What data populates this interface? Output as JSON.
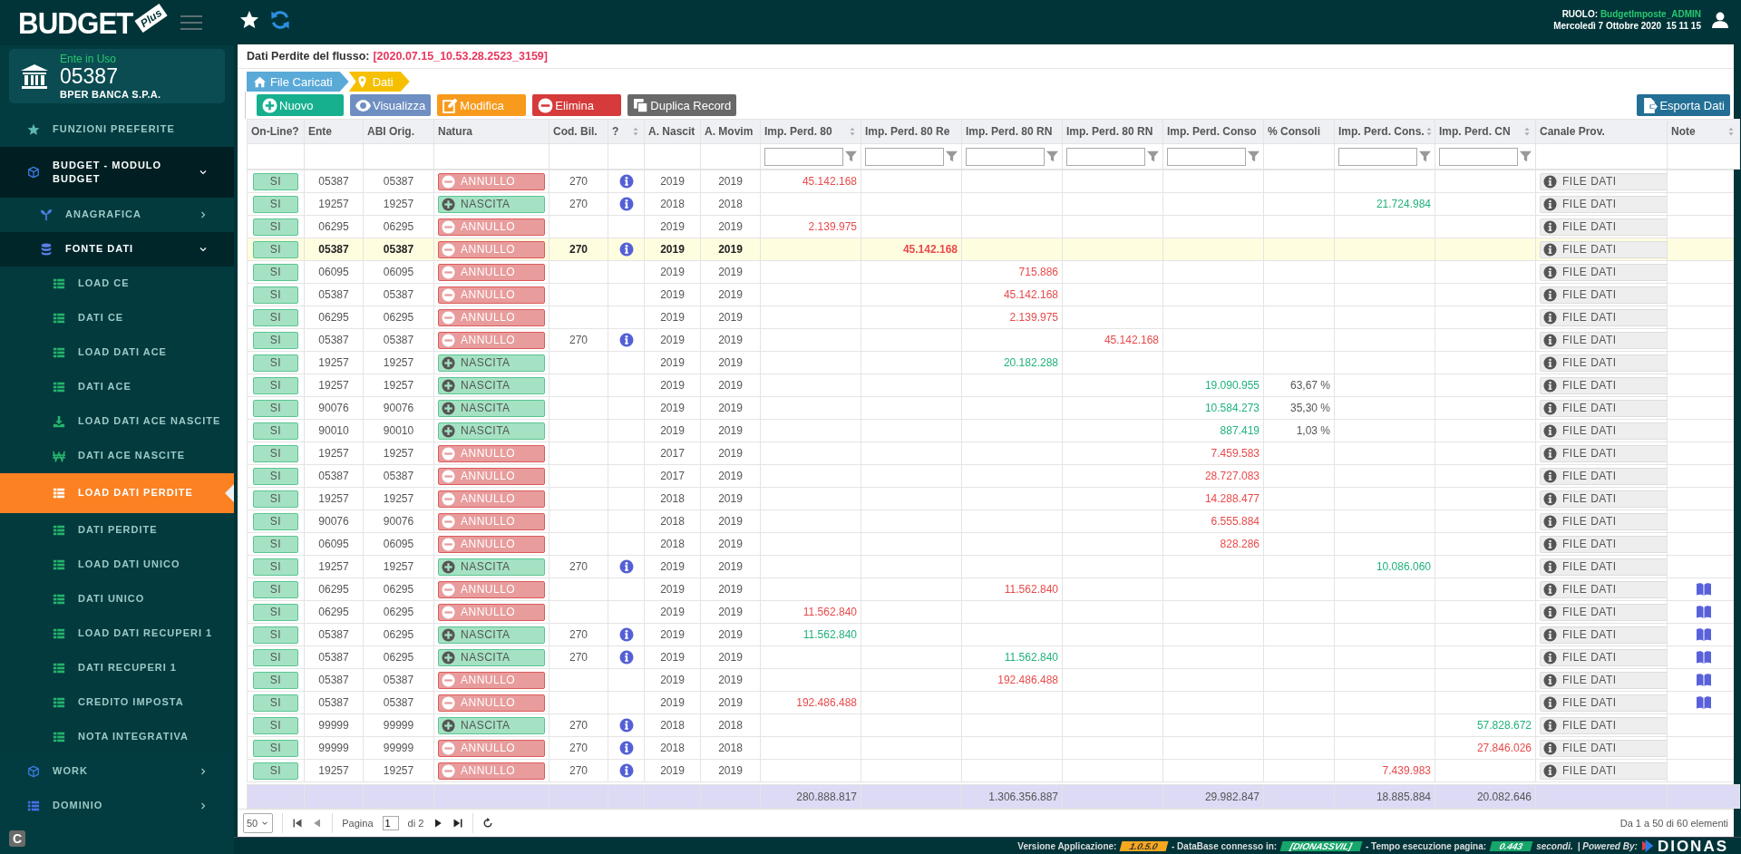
{
  "header": {
    "role_label": "RUOLO:",
    "role": "BudgetImposte_ADMIN",
    "datetime": "Mercoledì 7 Ottobre 2020  15 11 15"
  },
  "sidebar": {
    "logo": {
      "title": "BUDGET",
      "badge": "Plus"
    },
    "ente": {
      "label": "Ente in Uso",
      "code": "05387",
      "name": "BPER BANCA S.P.A."
    },
    "items": [
      {
        "label": "FUNZIONI PREFERITE",
        "kind": "favorites"
      },
      {
        "label": "BUDGET - MODULO BUDGET",
        "kind": "module",
        "expanded": true,
        "children": [
          {
            "label": "ANAGRAFICA",
            "kind": "branch",
            "expanded": false
          },
          {
            "label": "FONTE DATI",
            "kind": "database",
            "expanded": true,
            "children": [
              {
                "label": "LOAD CE",
                "kind": "table",
                "selected": false
              },
              {
                "label": "DATI CE",
                "kind": "table",
                "selected": false
              },
              {
                "label": "LOAD DATI ACE",
                "kind": "table",
                "selected": false
              },
              {
                "label": "DATI ACE",
                "kind": "table",
                "selected": false
              },
              {
                "label": "LOAD DATI ACE NASCITE",
                "kind": "import",
                "selected": false
              },
              {
                "label": "DATI ACE NASCITE",
                "kind": "currency",
                "selected": false
              },
              {
                "label": "LOAD DATI PERDITE",
                "kind": "table",
                "selected": true
              },
              {
                "label": "DATI PERDITE",
                "kind": "table",
                "selected": false
              },
              {
                "label": "LOAD DATI UNICO",
                "kind": "table",
                "selected": false
              },
              {
                "label": "DATI UNICO",
                "kind": "table",
                "selected": false
              },
              {
                "label": "LOAD DATI RECUPERI 1",
                "kind": "table",
                "selected": false
              },
              {
                "label": "DATI RECUPERI 1",
                "kind": "table",
                "selected": false
              },
              {
                "label": "CREDITO IMPOSTA",
                "kind": "table",
                "selected": false
              },
              {
                "label": "NOTA INTEGRATIVA",
                "kind": "table",
                "selected": false
              }
            ]
          }
        ]
      },
      {
        "label": "WORK",
        "kind": "module",
        "expanded": false
      },
      {
        "label": "DOMINIO",
        "kind": "list",
        "expanded": false
      }
    ],
    "corner_badge": "C"
  },
  "panel": {
    "title": "Dati Perdite del flusso:",
    "flow": "[2020.07.15_10.53.28.2523_3159]",
    "breadcrumb": [
      {
        "label": "File Caricati",
        "kind": "home"
      },
      {
        "label": "Dati",
        "kind": "pin"
      }
    ],
    "toolbar": [
      {
        "label": "Nuovo",
        "kind": "new"
      },
      {
        "label": "Visualizza",
        "kind": "view"
      },
      {
        "label": "Modifica",
        "kind": "edit"
      },
      {
        "label": "Elimina",
        "kind": "delete"
      },
      {
        "label": "Duplica Record",
        "kind": "duplicate"
      },
      {
        "label": "Esporta Dati",
        "kind": "export"
      }
    ],
    "table": {
      "columns": [
        {
          "label": "On-Line?",
          "sort_icon": false,
          "filter": false
        },
        {
          "label": "Ente",
          "sort_icon": false,
          "filter": false
        },
        {
          "label": "ABI Orig.",
          "sort_icon": false,
          "filter": false
        },
        {
          "label": "Natura",
          "sort_icon": false,
          "filter": false
        },
        {
          "label": "Cod. Bil.",
          "sort_icon": false,
          "filter": false
        },
        {
          "label": "?",
          "sort_icon": true,
          "filter": false
        },
        {
          "label": "A. Nascit",
          "sort_icon": false,
          "filter": false
        },
        {
          "label": "A. Movim",
          "sort_icon": false,
          "filter": false
        },
        {
          "label": "Imp. Perd. 80",
          "sort_icon": true,
          "filter": true
        },
        {
          "label": "Imp. Perd. 80 Re",
          "sort_icon": false,
          "filter": true
        },
        {
          "label": "Imp. Perd. 80 RN",
          "sort_icon": false,
          "filter": true
        },
        {
          "label": "Imp. Perd. 80 RN",
          "sort_icon": false,
          "filter": true
        },
        {
          "label": "Imp. Perd. Conso",
          "sort_icon": false,
          "filter": true
        },
        {
          "label": "% Consoli",
          "sort_icon": false,
          "filter": false
        },
        {
          "label": "Imp. Perd. Cons.",
          "sort_icon": true,
          "filter": true
        },
        {
          "label": "Imp. Perd. CN",
          "sort_icon": true,
          "filter": true
        },
        {
          "label": "Canale Prov.",
          "sort_icon": false,
          "filter": false
        },
        {
          "label": "Note",
          "sort_icon": true,
          "filter": false
        }
      ],
      "rows": [
        {
          "online": "SI",
          "ente": "05387",
          "abi_orig": "05387",
          "natura": {
            "label": "ANNULLO",
            "kind": "annullo"
          },
          "cod_bil": "270",
          "info": true,
          "a_nascita": "2019",
          "a_movim": "2019",
          "imp_perd_80": {
            "value": "45.142.168",
            "kind": "negative"
          },
          "canale": "FILE DATI",
          "note": false,
          "selected": false
        },
        {
          "online": "SI",
          "ente": "19257",
          "abi_orig": "19257",
          "natura": {
            "label": "NASCITA",
            "kind": "nascita"
          },
          "cod_bil": "270",
          "info": true,
          "a_nascita": "2018",
          "a_movim": "2018",
          "imp_perd_cons": {
            "value": "21.724.984",
            "kind": "positive"
          },
          "canale": "FILE DATI",
          "note": false,
          "selected": false
        },
        {
          "online": "SI",
          "ente": "06295",
          "abi_orig": "06295",
          "natura": {
            "label": "ANNULLO",
            "kind": "annullo"
          },
          "info": false,
          "a_nascita": "2019",
          "a_movim": "2019",
          "imp_perd_80": {
            "value": "2.139.975",
            "kind": "negative"
          },
          "canale": "FILE DATI",
          "note": false,
          "selected": false
        },
        {
          "online": "SI",
          "ente": "05387",
          "abi_orig": "05387",
          "natura": {
            "label": "ANNULLO",
            "kind": "annullo"
          },
          "cod_bil": "270",
          "info": true,
          "a_nascita": "2019",
          "a_movim": "2019",
          "imp_perd_80_rec": {
            "value": "45.142.168",
            "kind": "negative"
          },
          "canale": "FILE DATI",
          "note": false,
          "selected": true
        },
        {
          "online": "SI",
          "ente": "06095",
          "abi_orig": "06095",
          "natura": {
            "label": "ANNULLO",
            "kind": "annullo"
          },
          "info": false,
          "a_nascita": "2019",
          "a_movim": "2019",
          "imp_perd_80_rn": {
            "value": "715.886",
            "kind": "negative"
          },
          "canale": "FILE DATI",
          "note": false,
          "selected": false
        },
        {
          "online": "SI",
          "ente": "05387",
          "abi_orig": "05387",
          "natura": {
            "label": "ANNULLO",
            "kind": "annullo"
          },
          "info": false,
          "a_nascita": "2019",
          "a_movim": "2019",
          "imp_perd_80_rn": {
            "value": "45.142.168",
            "kind": "negative"
          },
          "canale": "FILE DATI",
          "note": false,
          "selected": false
        },
        {
          "online": "SI",
          "ente": "06295",
          "abi_orig": "06295",
          "natura": {
            "label": "ANNULLO",
            "kind": "annullo"
          },
          "info": false,
          "a_nascita": "2019",
          "a_movim": "2019",
          "imp_perd_80_rn": {
            "value": "2.139.975",
            "kind": "negative"
          },
          "canale": "FILE DATI",
          "note": false,
          "selected": false
        },
        {
          "online": "SI",
          "ente": "05387",
          "abi_orig": "05387",
          "natura": {
            "label": "ANNULLO",
            "kind": "annullo"
          },
          "cod_bil": "270",
          "info": true,
          "a_nascita": "2019",
          "a_movim": "2019",
          "imp_perd_80_rn_2": {
            "value": "45.142.168",
            "kind": "negative"
          },
          "canale": "FILE DATI",
          "note": false,
          "selected": false
        },
        {
          "online": "SI",
          "ente": "19257",
          "abi_orig": "19257",
          "natura": {
            "label": "NASCITA",
            "kind": "nascita"
          },
          "info": false,
          "a_nascita": "2019",
          "a_movim": "2019",
          "imp_perd_80_rn": {
            "value": "20.182.288",
            "kind": "positive"
          },
          "canale": "FILE DATI",
          "note": false,
          "selected": false
        },
        {
          "online": "SI",
          "ente": "19257",
          "abi_orig": "19257",
          "natura": {
            "label": "NASCITA",
            "kind": "nascita"
          },
          "info": false,
          "a_nascita": "2019",
          "a_movim": "2019",
          "imp_perd_conso": {
            "value": "19.090.955",
            "kind": "positive"
          },
          "pct_consoli": "63,67 %",
          "canale": "FILE DATI",
          "note": false,
          "selected": false
        },
        {
          "online": "SI",
          "ente": "90076",
          "abi_orig": "90076",
          "natura": {
            "label": "NASCITA",
            "kind": "nascita"
          },
          "info": false,
          "a_nascita": "2019",
          "a_movim": "2019",
          "imp_perd_conso": {
            "value": "10.584.273",
            "kind": "positive"
          },
          "pct_consoli": "35,30 %",
          "canale": "FILE DATI",
          "note": false,
          "selected": false
        },
        {
          "online": "SI",
          "ente": "90010",
          "abi_orig": "90010",
          "natura": {
            "label": "NASCITA",
            "kind": "nascita"
          },
          "info": false,
          "a_nascita": "2019",
          "a_movim": "2019",
          "imp_perd_conso": {
            "value": "887.419",
            "kind": "positive"
          },
          "pct_consoli": "1,03 %",
          "canale": "FILE DATI",
          "note": false,
          "selected": false
        },
        {
          "online": "SI",
          "ente": "19257",
          "abi_orig": "19257",
          "natura": {
            "label": "ANNULLO",
            "kind": "annullo"
          },
          "info": false,
          "a_nascita": "2017",
          "a_movim": "2019",
          "imp_perd_conso": {
            "value": "7.459.583",
            "kind": "negative"
          },
          "canale": "FILE DATI",
          "note": false,
          "selected": false
        },
        {
          "online": "SI",
          "ente": "05387",
          "abi_orig": "05387",
          "natura": {
            "label": "ANNULLO",
            "kind": "annullo"
          },
          "info": false,
          "a_nascita": "2017",
          "a_movim": "2019",
          "imp_perd_conso": {
            "value": "28.727.083",
            "kind": "negative"
          },
          "canale": "FILE DATI",
          "note": false,
          "selected": false
        },
        {
          "online": "SI",
          "ente": "19257",
          "abi_orig": "19257",
          "natura": {
            "label": "ANNULLO",
            "kind": "annullo"
          },
          "info": false,
          "a_nascita": "2018",
          "a_movim": "2019",
          "imp_perd_conso": {
            "value": "14.288.477",
            "kind": "negative"
          },
          "canale": "FILE DATI",
          "note": false,
          "selected": false
        },
        {
          "online": "SI",
          "ente": "90076",
          "abi_orig": "90076",
          "natura": {
            "label": "ANNULLO",
            "kind": "annullo"
          },
          "info": false,
          "a_nascita": "2018",
          "a_movim": "2019",
          "imp_perd_conso": {
            "value": "6.555.884",
            "kind": "negative"
          },
          "canale": "FILE DATI",
          "note": false,
          "selected": false
        },
        {
          "online": "SI",
          "ente": "06095",
          "abi_orig": "06095",
          "natura": {
            "label": "ANNULLO",
            "kind": "annullo"
          },
          "info": false,
          "a_nascita": "2018",
          "a_movim": "2019",
          "imp_perd_conso": {
            "value": "828.286",
            "kind": "negative"
          },
          "canale": "FILE DATI",
          "note": false,
          "selected": false
        },
        {
          "online": "SI",
          "ente": "19257",
          "abi_orig": "19257",
          "natura": {
            "label": "NASCITA",
            "kind": "nascita"
          },
          "cod_bil": "270",
          "info": true,
          "a_nascita": "2019",
          "a_movim": "2019",
          "imp_perd_cons": {
            "value": "10.086.060",
            "kind": "positive"
          },
          "canale": "FILE DATI",
          "note": false,
          "selected": false
        },
        {
          "online": "SI",
          "ente": "06295",
          "abi_orig": "06295",
          "natura": {
            "label": "ANNULLO",
            "kind": "annullo"
          },
          "info": false,
          "a_nascita": "2019",
          "a_movim": "2019",
          "imp_perd_80_rn": {
            "value": "11.562.840",
            "kind": "negative"
          },
          "canale": "FILE DATI",
          "note": true,
          "selected": false
        },
        {
          "online": "SI",
          "ente": "06295",
          "abi_orig": "06295",
          "natura": {
            "label": "ANNULLO",
            "kind": "annullo"
          },
          "info": false,
          "a_nascita": "2019",
          "a_movim": "2019",
          "imp_perd_80": {
            "value": "11.562.840",
            "kind": "negative"
          },
          "canale": "FILE DATI",
          "note": true,
          "selected": false
        },
        {
          "online": "SI",
          "ente": "05387",
          "abi_orig": "06295",
          "natura": {
            "label": "NASCITA",
            "kind": "nascita"
          },
          "cod_bil": "270",
          "info": true,
          "a_nascita": "2019",
          "a_movim": "2019",
          "imp_perd_80": {
            "value": "11.562.840",
            "kind": "positive"
          },
          "canale": "FILE DATI",
          "note": true,
          "selected": false
        },
        {
          "online": "SI",
          "ente": "05387",
          "abi_orig": "06295",
          "natura": {
            "label": "NASCITA",
            "kind": "nascita"
          },
          "cod_bil": "270",
          "info": true,
          "a_nascita": "2019",
          "a_movim": "2019",
          "imp_perd_80_rn": {
            "value": "11.562.840",
            "kind": "positive"
          },
          "canale": "FILE DATI",
          "note": true,
          "selected": false
        },
        {
          "online": "SI",
          "ente": "05387",
          "abi_orig": "05387",
          "natura": {
            "label": "ANNULLO",
            "kind": "annullo"
          },
          "info": false,
          "a_nascita": "2019",
          "a_movim": "2019",
          "imp_perd_80_rn": {
            "value": "192.486.488",
            "kind": "negative"
          },
          "canale": "FILE DATI",
          "note": true,
          "selected": false
        },
        {
          "online": "SI",
          "ente": "05387",
          "abi_orig": "05387",
          "natura": {
            "label": "ANNULLO",
            "kind": "annullo"
          },
          "info": false,
          "a_nascita": "2019",
          "a_movim": "2019",
          "imp_perd_80": {
            "value": "192.486.488",
            "kind": "negative"
          },
          "canale": "FILE DATI",
          "note": true,
          "selected": false
        },
        {
          "online": "SI",
          "ente": "99999",
          "abi_orig": "99999",
          "natura": {
            "label": "NASCITA",
            "kind": "nascita"
          },
          "cod_bil": "270",
          "info": true,
          "a_nascita": "2018",
          "a_movim": "2018",
          "imp_perd_cn": {
            "value": "57.828.672",
            "kind": "positive"
          },
          "canale": "FILE DATI",
          "note": false,
          "selected": false
        },
        {
          "online": "SI",
          "ente": "99999",
          "abi_orig": "99999",
          "natura": {
            "label": "ANNULLO",
            "kind": "annullo"
          },
          "cod_bil": "270",
          "info": true,
          "a_nascita": "2018",
          "a_movim": "2018",
          "imp_perd_cn": {
            "value": "27.846.026",
            "kind": "negative"
          },
          "canale": "FILE DATI",
          "note": false,
          "selected": false
        },
        {
          "online": "SI",
          "ente": "19257",
          "abi_orig": "19257",
          "natura": {
            "label": "ANNULLO",
            "kind": "annullo"
          },
          "cod_bil": "270",
          "info": true,
          "a_nascita": "2019",
          "a_movim": "2019",
          "imp_perd_cons": {
            "value": "7.439.983",
            "kind": "negative"
          },
          "canale": "FILE DATI",
          "note": false,
          "selected": false
        }
      ],
      "totals": {
        "imp_perd_80": "280.888.817",
        "imp_perd_80_rn": "1.306.356.887",
        "imp_perd_conso": "29.982.847",
        "imp_perd_cons": "18.885.884",
        "imp_perd_cn": "20.082.646"
      }
    },
    "pager": {
      "page_size": "50",
      "page_label": "Pagina",
      "page": "1",
      "of_label": "di 2",
      "summary": "Da 1 a 50 di 60 elementi"
    }
  },
  "status_bar": [
    {
      "text": "Versione Applicazione:",
      "kind": "label"
    },
    {
      "text": "1.0.5.0",
      "kind": "version"
    },
    {
      "text": "- DataBase connesso in:",
      "kind": "label"
    },
    {
      "text": "[DIONASSVIL]",
      "kind": "badge"
    },
    {
      "text": "- Tempo esecuzione pagina:",
      "kind": "label"
    },
    {
      "text": "0.443",
      "kind": "badge"
    },
    {
      "text": "secondi.",
      "kind": "italic"
    },
    {
      "text": "| Powered By:",
      "kind": "italic"
    },
    {
      "text": "DIONAS",
      "kind": "logo"
    }
  ]
}
